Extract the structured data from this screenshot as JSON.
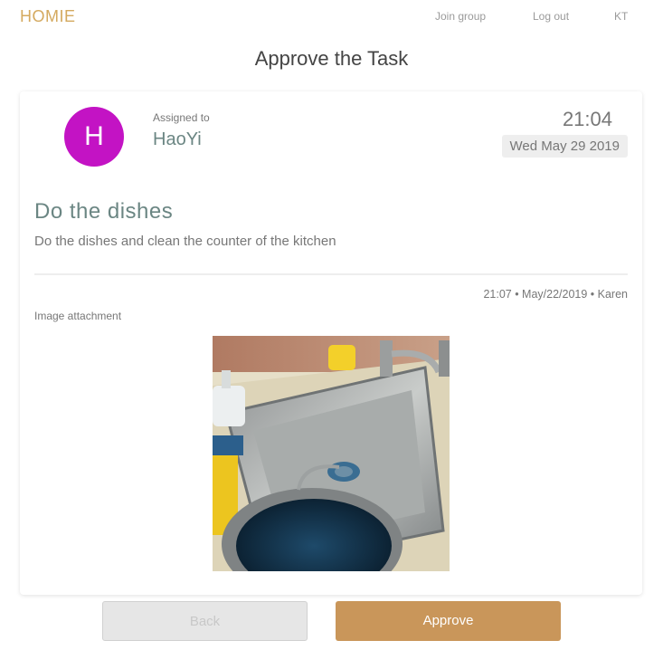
{
  "header": {
    "brand": "HOMIE",
    "nav": {
      "join_group": "Join group",
      "log_out": "Log out",
      "user_initials": "KT"
    }
  },
  "page": {
    "title": "Approve the Task"
  },
  "task": {
    "avatar_letter": "H",
    "assigned_label": "Assigned to",
    "assignee": "HaoYi",
    "time": "21:04",
    "date": "Wed May 29 2019",
    "title": "Do the dishes",
    "description": "Do the dishes and clean the counter of the kitchen",
    "meta": "21:07 • May/22/2019 • Karen",
    "attachment_label": "Image attachment"
  },
  "actions": {
    "back_label": "Back",
    "approve_label": "Approve"
  },
  "colors": {
    "brand": "#d4a95f",
    "avatar_bg": "#c313c4",
    "accent_text": "#6b8683",
    "approve_bg": "#c9965a"
  }
}
